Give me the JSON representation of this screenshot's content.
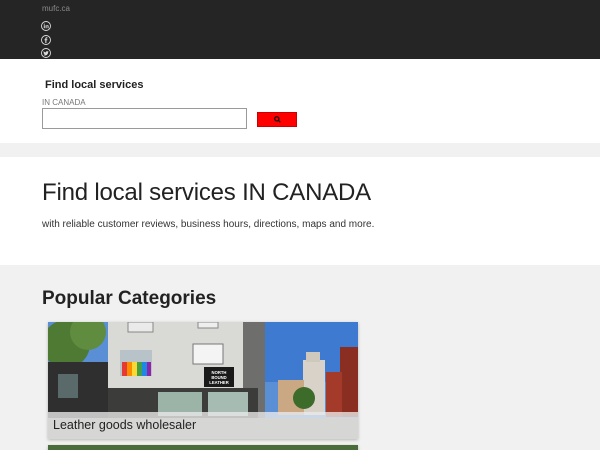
{
  "header": {
    "site_name": "mufc.ca",
    "social_icons": [
      "linkedin-icon",
      "facebook-icon",
      "twitter-icon"
    ]
  },
  "search": {
    "heading": "Find local services",
    "sublabel": "IN CANADA",
    "value": "",
    "placeholder": "",
    "button_icon": "search-icon",
    "button_color": "#ff0000"
  },
  "hero": {
    "title": "Find local services IN CANADA",
    "subtitle": "with reliable customer reviews, business hours, directions, maps and more."
  },
  "popular": {
    "title": "Popular Categories",
    "categories": [
      {
        "label": "Leather goods wholesaler",
        "sign_text": "NORTH BOUND LEATHER"
      }
    ]
  },
  "colors": {
    "topbar": "#252525",
    "accent": "#ff0000",
    "background": "#f1f1f1"
  }
}
